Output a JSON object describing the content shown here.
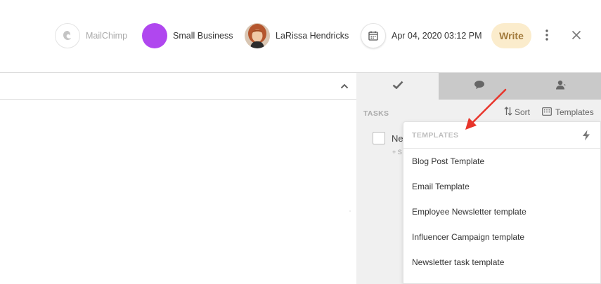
{
  "header": {
    "mailchimp": {
      "label": "MailChimp",
      "icon": "mailchimp-logo-icon"
    },
    "business": {
      "label": "Small Business",
      "color": "#b047ef"
    },
    "person": {
      "name": "LaRissa Hendricks",
      "icon": "avatar"
    },
    "date": {
      "label": "Apr 04, 2020 03:12 PM",
      "icon": "calendar-icon"
    },
    "write_label": "Write",
    "more_icon": "more-vertical-icon",
    "close_icon": "close-icon"
  },
  "main": {
    "collapse_icon": "chevron-up-icon"
  },
  "sidebar": {
    "tabs": [
      {
        "name": "tasks",
        "icon": "checkmark-icon",
        "active": true
      },
      {
        "name": "comments",
        "icon": "chat-bubble-icon",
        "active": false
      },
      {
        "name": "contacts",
        "icon": "person-icon",
        "active": false
      }
    ],
    "tasks_title": "TASKS",
    "sort_label": "Sort",
    "templates_label": "Templates",
    "task": {
      "text": "Ne",
      "sub": "+ S"
    }
  },
  "templates_dropdown": {
    "title": "TEMPLATES",
    "bolt_icon": "lightning-bolt-icon",
    "items": [
      {
        "label": "Blog Post Template"
      },
      {
        "label": "Email Template"
      },
      {
        "label": "Employee Newsletter template"
      },
      {
        "label": "Influencer Campaign template"
      },
      {
        "label": "Newsletter task template"
      }
    ]
  },
  "annotation": {
    "color": "#e8352b"
  }
}
